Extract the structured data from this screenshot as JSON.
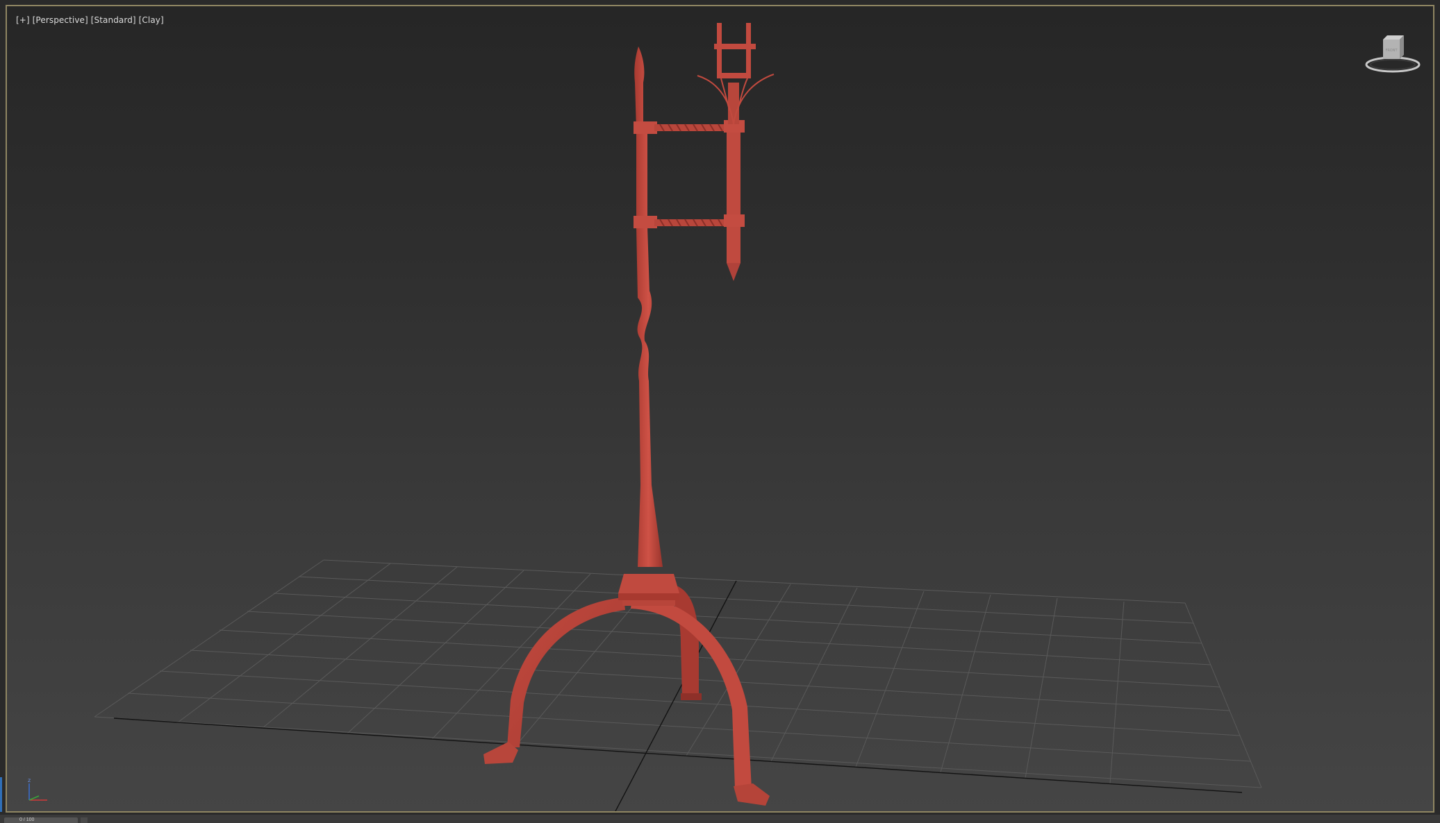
{
  "viewport": {
    "label_parts": [
      "[+]",
      "[Perspective]",
      "[Standard]",
      "[Clay]"
    ],
    "border_color": "#8f8662",
    "background_top": "#262626",
    "background_bottom": "#454545"
  },
  "model": {
    "name": "wrought-iron candle stand",
    "color": "#c0453a"
  },
  "grid": {
    "color": "#5a5a5a",
    "axis_color": "#111111"
  },
  "viewcube": {
    "face_label": "FRONT"
  },
  "gizmo": {
    "x_color": "#d23a3a",
    "y_color": "#3aa63a",
    "z_color": "#3a6fd2",
    "z_label": "z"
  },
  "status": {
    "tab_label": "0 / 100"
  }
}
